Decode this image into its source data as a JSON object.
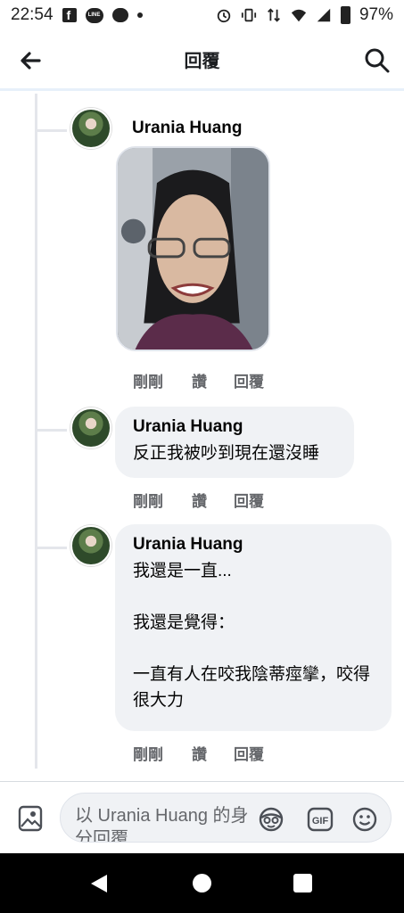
{
  "status_bar": {
    "time": "22:54",
    "battery": "97%"
  },
  "header": {
    "title": "回覆"
  },
  "comments": [
    {
      "author": "Urania Huang",
      "type": "photo",
      "time": "剛剛",
      "like": "讚",
      "reply": "回覆"
    },
    {
      "author": "Urania Huang",
      "text": "反正我被吵到現在還沒睡",
      "time": "剛剛",
      "like": "讚",
      "reply": "回覆"
    },
    {
      "author": "Urania Huang",
      "text": "我還是一直...\n\n我還是覺得：\n\n一直有人在咬我陰蒂痙攣，咬得很大力",
      "time": "剛剛",
      "like": "讚",
      "reply": "回覆"
    }
  ],
  "composer": {
    "placeholder": "以 Urania Huang 的身分回覆"
  },
  "icons": {
    "back": "arrow-left-icon",
    "search": "search-icon",
    "gallery": "image-icon",
    "avatar_sticker": "sticker-icon",
    "gif": "gif-icon",
    "emoji": "emoji-icon"
  }
}
